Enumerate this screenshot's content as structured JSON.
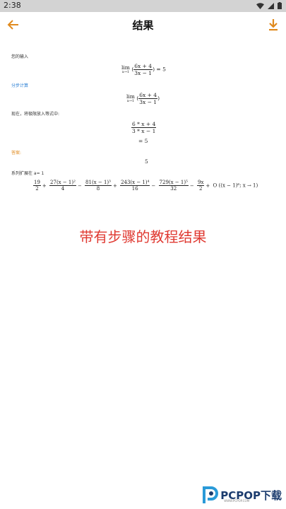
{
  "status": {
    "time": "2:38"
  },
  "appbar": {
    "title": "结果"
  },
  "content": {
    "your_input_label": "您的输入",
    "input_expr": {
      "lim_sub": "x→1",
      "num": "6x + 4",
      "den": "3x − 1",
      "result": "= 5"
    },
    "steps_label": "分步计算",
    "step_expr": {
      "lim_sub": "x→1",
      "num": "6x + 4",
      "den": "3x − 1"
    },
    "substitute_label": "现在，将极限放入等式中:",
    "sub_frac": {
      "num": "6 * x + 4",
      "den": "3 * x − 1"
    },
    "sub_result": "= 5",
    "answer_label": "答案:",
    "answer_value": "5",
    "series_label": "系列扩展在 a= 1",
    "series": [
      {
        "num": "19",
        "den": "2",
        "op": "+"
      },
      {
        "num": "27(x − 1)²",
        "den": "4",
        "op": "−"
      },
      {
        "num": "81(x − 1)³",
        "den": "8",
        "op": "+"
      },
      {
        "num": "243(x − 1)⁴",
        "den": "16",
        "op": "−"
      },
      {
        "num": "729(x − 1)⁵",
        "den": "32",
        "op": "−"
      },
      {
        "num": "9x",
        "den": "2",
        "op": "+"
      }
    ],
    "series_tail": "O ((x − 1)⁶; x → 1)"
  },
  "caption": "带有步骤的教程结果",
  "watermark": {
    "brand": "PCPOP下载",
    "sub": "WWW.PCPOP.COM"
  },
  "colors": {
    "accent": "#e08a1e",
    "blue": "#2a7fd4",
    "caption": "#e03a32",
    "statusbar": "#d3d3d3"
  }
}
